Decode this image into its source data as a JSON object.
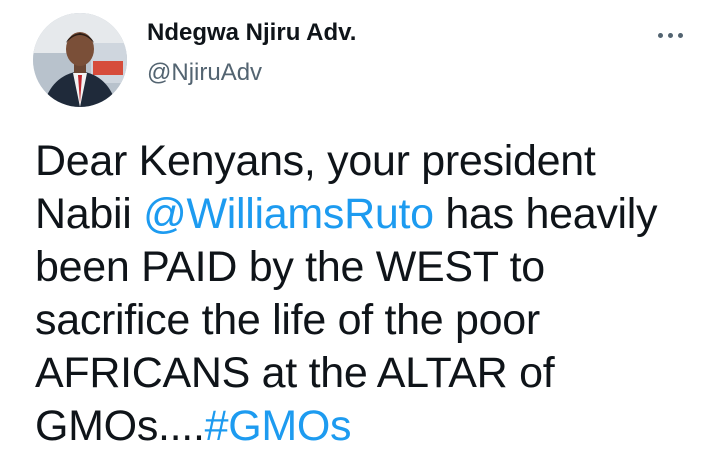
{
  "author": {
    "display_name": "Ndegwa Njiru Adv.",
    "handle": "@NjiruAdv",
    "avatar_icon": "profile-photo"
  },
  "menu": {
    "icon": "more-horizontal-icon"
  },
  "tweet": {
    "line1": "Dear Kenyans, your president",
    "line2_prefix": "Nabii ",
    "mention": "@WilliamsRuto",
    "line2_suffix": " has heavily",
    "line3": "been PAID by the WEST to",
    "line4": "sacrifice the life of the poor",
    "line5": "AFRICANS at the ALTAR of",
    "line6_prefix": "GMOs....",
    "hashtag": "#GMOs"
  },
  "colors": {
    "link": "#1d9bf0",
    "secondary_text": "#536471",
    "primary_text": "#0f1419"
  }
}
